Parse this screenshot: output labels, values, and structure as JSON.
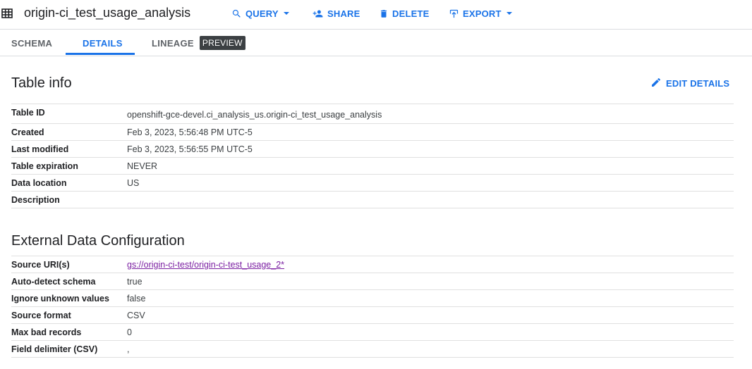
{
  "header": {
    "table_icon": "table-grid-icon",
    "title": "origin-ci_test_usage_analysis",
    "actions": [
      {
        "label": "QUERY",
        "icon": "search-icon",
        "dropdown": true
      },
      {
        "label": "SHARE",
        "icon": "person-add-icon",
        "dropdown": false
      },
      {
        "label": "DELETE",
        "icon": "trash-icon",
        "dropdown": false
      },
      {
        "label": "EXPORT",
        "icon": "upload-icon",
        "dropdown": true
      }
    ]
  },
  "tabs": [
    {
      "label": "SCHEMA",
      "active": false
    },
    {
      "label": "DETAILS",
      "active": true
    },
    {
      "label": "LINEAGE",
      "active": false,
      "badge": "PREVIEW"
    }
  ],
  "table_info": {
    "title": "Table info",
    "edit_label": "EDIT DETAILS",
    "rows": [
      {
        "key": "Table ID",
        "value": "openshift-gce-devel.ci_analysis_us.origin-ci_test_usage_analysis"
      },
      {
        "key": "Created",
        "value": "Feb 3, 2023, 5:56:48 PM UTC-5"
      },
      {
        "key": "Last modified",
        "value": "Feb 3, 2023, 5:56:55 PM UTC-5"
      },
      {
        "key": "Table expiration",
        "value": "NEVER"
      },
      {
        "key": "Data location",
        "value": "US"
      },
      {
        "key": "Description",
        "value": ""
      }
    ]
  },
  "external_config": {
    "title": "External Data Configuration",
    "rows": [
      {
        "key": "Source URI(s)",
        "value": "gs://origin-ci-test/origin-ci-test_usage_2*",
        "link": true
      },
      {
        "key": "Auto-detect schema",
        "value": "true"
      },
      {
        "key": "Ignore unknown values",
        "value": "false"
      },
      {
        "key": "Source format",
        "value": "CSV"
      },
      {
        "key": "Max bad records",
        "value": "0"
      },
      {
        "key": "Field delimiter (CSV)",
        "value": ","
      }
    ]
  },
  "colors": {
    "accent": "#1a73e8",
    "link_visited": "#7b1fa2",
    "divider": "#e0e0e0",
    "badge_bg": "#3c4043"
  }
}
